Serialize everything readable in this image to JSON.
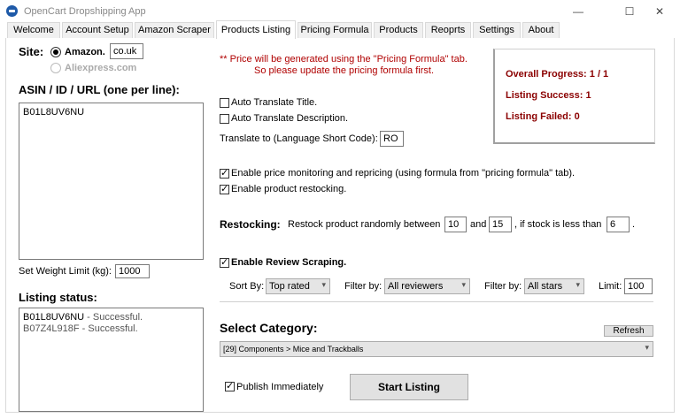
{
  "window": {
    "title": "OpenCart Dropshipping App",
    "minimize": "—",
    "maximize": "☐",
    "close": "✕"
  },
  "tabs": [
    {
      "label": "Welcome"
    },
    {
      "label": "Account Setup"
    },
    {
      "label": "Amazon Scraper"
    },
    {
      "label": "Products Listing"
    },
    {
      "label": "Pricing Formula"
    },
    {
      "label": "Products"
    },
    {
      "label": "Reoprts"
    },
    {
      "label": "Settings"
    },
    {
      "label": "About"
    }
  ],
  "site": {
    "label": "Site:",
    "amazon_label": "Amazon.",
    "amazon_selected": true,
    "domain_value": "co.uk",
    "aliexpress_label": "Aliexpress.com"
  },
  "asin": {
    "label": "ASIN / ID / URL (one per line):",
    "value": "B01L8UV6NU"
  },
  "weight": {
    "label": "Set Weight Limit (kg):",
    "value": "1000"
  },
  "listing_status": {
    "label": "Listing status:",
    "lines": [
      {
        "id": "B01L8UV6NU",
        "status": " - Successful."
      },
      {
        "id": "B07Z4L918F",
        "status": " - Successful."
      }
    ]
  },
  "notice": {
    "line1": "** Price will be generated using the \"Pricing Formula\" tab.",
    "line2": "So please update the pricing formula first."
  },
  "progress": {
    "overall": "Overall Progress: 1 / 1",
    "success": "Listing Success: 1",
    "failed": "Listing Failed: 0"
  },
  "translate": {
    "title_label": "Auto Translate Title.",
    "title_checked": false,
    "desc_label": "Auto Translate Description.",
    "desc_checked": false,
    "lang_label": "Translate to (Language Short Code):",
    "lang_value": "RO"
  },
  "monitoring": {
    "label": "Enable price monitoring and repricing (using formula from \"pricing formula\" tab).",
    "checked": true
  },
  "restocking_enable": {
    "label": "Enable product restocking.",
    "checked": true
  },
  "restocking": {
    "label": "Restocking:",
    "text1": "Restock product randomly between",
    "min": "10",
    "and": "and",
    "max": "15",
    "text2": ", if stock is less than",
    "threshold": "6",
    "end": "."
  },
  "review": {
    "label": "Enable Review Scraping.",
    "checked": true,
    "sort_label": "Sort By:",
    "sort_value": "Top rated",
    "filter1_label": "Filter by:",
    "filter1_value": "All reviewers",
    "filter2_label": "Filter by:",
    "filter2_value": "All stars",
    "limit_label": "Limit:",
    "limit_value": "100"
  },
  "category": {
    "label": "Select Category:",
    "refresh": "Refresh",
    "value": "[29] Components > Mice and Trackballs"
  },
  "publish": {
    "label": "Publish Immediately",
    "checked": true
  },
  "start_button": "Start Listing",
  "icons": {
    "app": "app-logo-icon",
    "dropdown": "▾"
  }
}
